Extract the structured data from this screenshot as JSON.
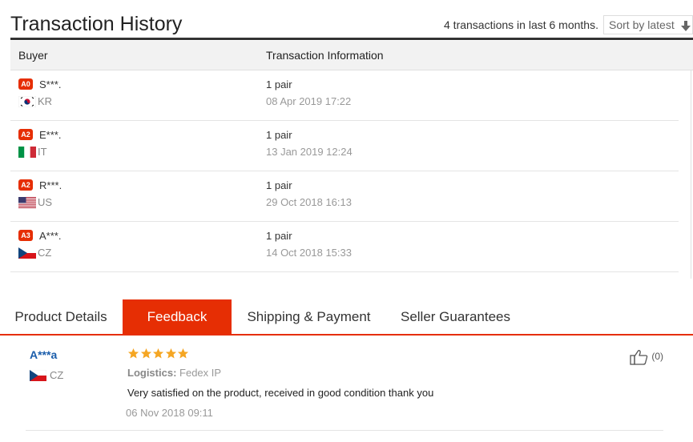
{
  "header": {
    "title": "Transaction History",
    "summary": "4 transactions in last 6 months.",
    "sort_label": "Sort by latest"
  },
  "columns": {
    "buyer": "Buyer",
    "info": "Transaction Information"
  },
  "transactions": [
    {
      "badge": "A0",
      "name": "S***.",
      "country": "KR",
      "flag": "kr-flag",
      "qty": "1 pair",
      "date": "08 Apr 2019 17:22"
    },
    {
      "badge": "A2",
      "name": "E***.",
      "country": "IT",
      "flag": "it-flag",
      "qty": "1 pair",
      "date": "13 Jan 2019 12:24"
    },
    {
      "badge": "A2",
      "name": "R***.",
      "country": "US",
      "flag": "us-flag",
      "qty": "1 pair",
      "date": "29 Oct 2018 16:13"
    },
    {
      "badge": "A3",
      "name": "A***.",
      "country": "CZ",
      "flag": "cz-flag",
      "qty": "1 pair",
      "date": "14 Oct 2018 15:33"
    }
  ],
  "tabs": [
    {
      "label": "Product Details",
      "active": false
    },
    {
      "label": "Feedback",
      "active": true
    },
    {
      "label": "Shipping & Payment",
      "active": false
    },
    {
      "label": "Seller Guarantees",
      "active": false
    }
  ],
  "feedback": {
    "user": "A***a",
    "country": "CZ",
    "flag": "cz-flag",
    "rating": 5,
    "logistics_label": "Logistics:",
    "logistics_value": "Fedex IP",
    "comment": "Very satisfied on the product, received in good condition  thank you",
    "date": "06 Nov 2018 09:11",
    "helpful_count": "(0)",
    "helpful_icon": "thumbs-up-icon"
  },
  "colors": {
    "accent": "#e62e04",
    "star": "#f5a623",
    "link": "#1a5dab"
  }
}
